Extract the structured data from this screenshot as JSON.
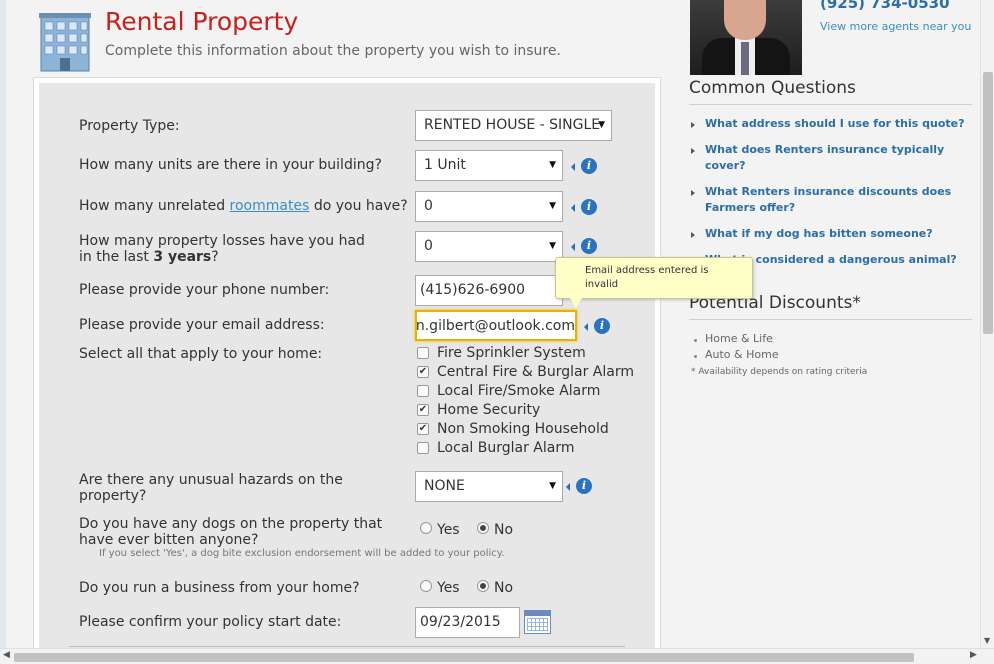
{
  "header": {
    "title": "Rental Property",
    "subtitle": "Complete this information about the property you wish to insure."
  },
  "form": {
    "property_type": {
      "label": "Property Type:",
      "value": "RENTED HOUSE - SINGLE"
    },
    "units": {
      "label": "How many units are there in your building?",
      "value": "1 Unit"
    },
    "roommates": {
      "label_before": "How many unrelated ",
      "link": "roommates",
      "label_after": " do you have?",
      "value": "0"
    },
    "losses": {
      "label_line1": "How many property losses have you had",
      "label_line2_before": "in the last ",
      "label_line2_bold": "3 years",
      "label_line2_after": "?",
      "value": "0"
    },
    "phone": {
      "label": "Please provide your phone number:",
      "value": "(415)626-6900"
    },
    "email": {
      "label": "Please provide your email address:",
      "value": "n.gilbert@outlook.com"
    },
    "email_tooltip": "Email address entered is invalid",
    "features": {
      "label": "Select all that apply to your home:",
      "options": [
        {
          "label": "Fire Sprinkler System",
          "checked": false
        },
        {
          "label": "Central Fire & Burglar Alarm",
          "checked": true
        },
        {
          "label": "Local Fire/Smoke Alarm",
          "checked": false
        },
        {
          "label": "Home Security",
          "checked": true
        },
        {
          "label": "Non Smoking Household",
          "checked": true
        },
        {
          "label": "Local Burglar Alarm",
          "checked": false
        }
      ]
    },
    "hazards": {
      "label_line1": "Are there any unusual hazards on the",
      "label_line2": "property?",
      "value": "NONE"
    },
    "dogs": {
      "label_line1": "Do you have any dogs on the property that",
      "label_line2": "have ever bitten anyone?",
      "yes": "Yes",
      "no": "No",
      "selected": "No",
      "note": "If you select 'Yes', a dog bite exclusion endorsement will be added to your policy."
    },
    "business": {
      "label": "Do you run a business from your home?",
      "yes": "Yes",
      "no": "No",
      "selected": "No"
    },
    "start_date": {
      "label": "Please confirm your policy start date:",
      "value": "09/23/2015"
    }
  },
  "agent": {
    "phone": "(925) 734-0530",
    "link": "View more agents near you"
  },
  "common_questions": {
    "heading": "Common Questions",
    "items": [
      {
        "line1": "What address should I use for this quote?",
        "line2": ""
      },
      {
        "line1": "What does Renters insurance typically",
        "line2": "cover?"
      },
      {
        "line1": "What Renters insurance discounts does",
        "line2": "Farmers offer?"
      },
      {
        "line1": "What if my dog has bitten someone?",
        "line2": ""
      },
      {
        "line1": "What is considered a dangerous animal?",
        "line2": ""
      }
    ]
  },
  "discounts": {
    "heading": "Potential Discounts*",
    "items": [
      "Home & Life",
      "Auto & Home"
    ],
    "note": "* Availability depends on rating criteria"
  },
  "icons": {
    "help": "info-icon",
    "calendar": "calendar-icon",
    "building": "building-icon"
  },
  "colors": {
    "title": "#c8201b",
    "link": "#2c6ea5",
    "tooltip_bg": "#ffffc8",
    "focus_border": "#e6b400"
  }
}
